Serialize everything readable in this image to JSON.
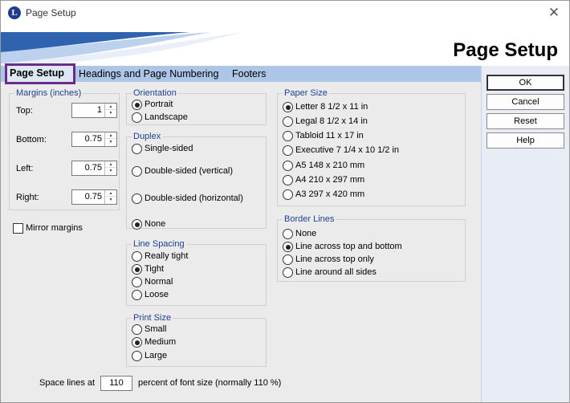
{
  "window": {
    "title": "Page Setup",
    "app_icon_letter": "L",
    "close_glyph": "✕",
    "banner_title": "Page Setup"
  },
  "tabs": [
    {
      "label": "Page Setup",
      "active": true
    },
    {
      "label": "Headings and Page Numbering",
      "active": false
    },
    {
      "label": "Footers",
      "active": false
    }
  ],
  "buttons": {
    "ok": "OK",
    "cancel": "Cancel",
    "reset": "Reset",
    "help": "Help"
  },
  "margins": {
    "legend": "Margins (inches)",
    "top": {
      "label": "Top:",
      "value": "1"
    },
    "bottom": {
      "label": "Bottom:",
      "value": "0.75"
    },
    "left": {
      "label": "Left:",
      "value": "0.75"
    },
    "right": {
      "label": "Right:",
      "value": "0.75"
    },
    "mirror_label": "Mirror margins",
    "mirror_checked": false
  },
  "orientation": {
    "legend": "Orientation",
    "options": [
      "Portrait",
      "Landscape"
    ],
    "selected": "Portrait"
  },
  "duplex": {
    "legend": "Duplex",
    "options": [
      "Single-sided",
      "Double-sided (vertical)",
      "Double-sided (horizontal)",
      "None"
    ],
    "selected": "None"
  },
  "line_spacing": {
    "legend": "Line Spacing",
    "options": [
      "Really tight",
      "Tight",
      "Normal",
      "Loose"
    ],
    "selected": "Tight"
  },
  "print_size": {
    "legend": "Print Size",
    "options": [
      "Small",
      "Medium",
      "Large"
    ],
    "selected": "Medium"
  },
  "paper_size": {
    "legend": "Paper Size",
    "options": [
      "Letter 8 1/2 x 11 in",
      "Legal 8 1/2 x 14 in",
      "Tabloid 11 x 17 in",
      "Executive 7 1/4 x 10 1/2 in",
      "A5 148 x 210 mm",
      "A4 210 x 297 mm",
      "A3 297 x 420 mm"
    ],
    "selected": "Letter 8 1/2 x 11 in"
  },
  "border_lines": {
    "legend": "Border Lines",
    "options": [
      "None",
      "Line across top and bottom",
      "Line across top only",
      "Line around all sides"
    ],
    "selected": "Line across top and bottom"
  },
  "space_lines": {
    "prefix": "Space lines at",
    "value": "110",
    "suffix": "percent of font size (normally 110 %)"
  },
  "colors": {
    "tab_strip": "#adc6e8",
    "active_tab_border": "#6b2c8e",
    "legend_text": "#1f3f8f",
    "banner_swoosh": "#2f63b0",
    "dialog_bg": "#ebebeb"
  }
}
